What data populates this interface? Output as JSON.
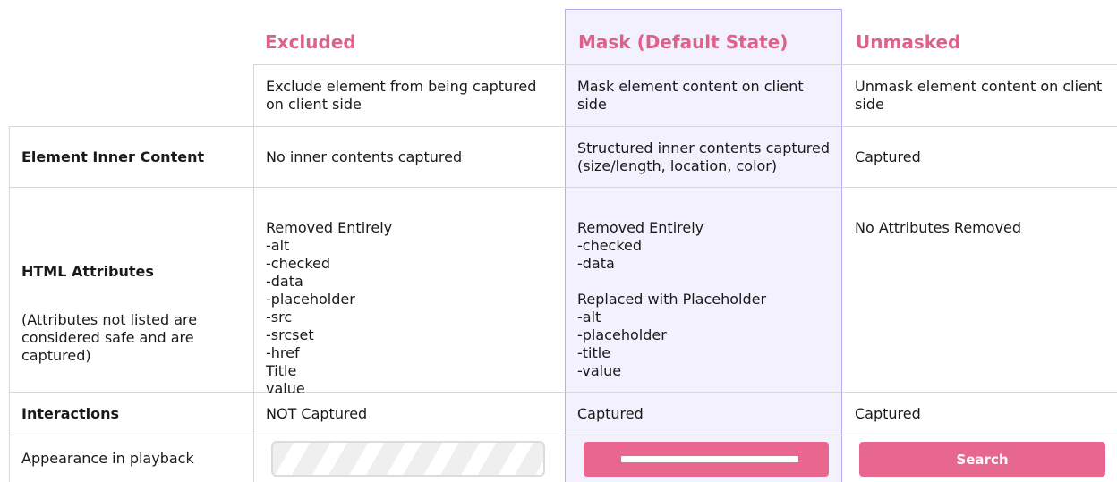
{
  "columns": {
    "excluded": {
      "title": "Excluded",
      "description": "Exclude element from being captured on client side"
    },
    "mask": {
      "title": "Mask (Default State)",
      "description": "Mask element content on client side"
    },
    "unmasked": {
      "title": "Unmasked",
      "description": "Unmask element content on client side"
    }
  },
  "rows": {
    "inner_content": {
      "label": "Element Inner Content",
      "excluded": "No inner contents captured",
      "mask": "Structured inner contents captured\n(size/length, location, color)",
      "unmasked": "Captured"
    },
    "html_attributes": {
      "label": "HTML Attributes",
      "note": "(Attributes not listed are\nconsidered safe and are\ncaptured)",
      "excluded": "Removed Entirely\n-alt\n-checked\n-data\n-placeholder\n-src\n-srcset\n-href\nTitle\nvalue",
      "mask": "Removed Entirely\n-checked\n-data\n\nReplaced with Placeholder\n-alt\n-placeholder\n-title\n-value",
      "unmasked": "No Attributes Removed"
    },
    "interactions": {
      "label": "Interactions",
      "excluded": "NOT Captured",
      "mask": "Captured",
      "unmasked": "Captured"
    },
    "appearance": {
      "label": "Appearance in playback",
      "unmasked_button": "Search"
    }
  },
  "colors": {
    "accent_pink": "#e0608c",
    "button_pink": "#e8678f",
    "mask_highlight": "#f3f1fd",
    "mask_border": "#b6aef0"
  }
}
